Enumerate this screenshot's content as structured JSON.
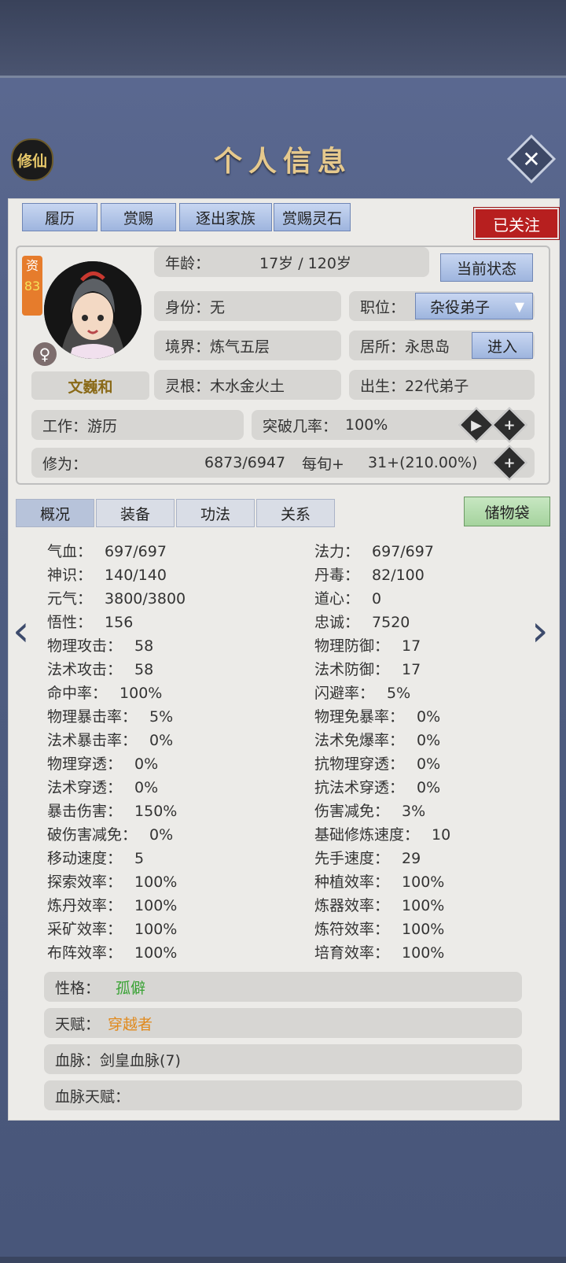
{
  "header": {
    "xiu_badge": "修仙",
    "title": "个人信息"
  },
  "actions": {
    "resume": "履历",
    "reward": "赏赐",
    "expel": "逐出家族",
    "reward_stones": "赏赐灵石",
    "followed": "已关注"
  },
  "profile": {
    "aptitude_label": "资",
    "aptitude_value": "83",
    "gender": "♀",
    "name": "文巍和",
    "age_label": "年龄：",
    "age_value": "17岁 / 120岁",
    "current_status_btn": "当前状态",
    "identity_label": "身份：",
    "identity_value": "无",
    "position_label": "职位：",
    "position_value": "杂役弟子",
    "realm_label": "境界：",
    "realm_value": "炼气五层",
    "residence_label": "居所：",
    "residence_value": "永思岛",
    "enter_btn": "进入",
    "root_label": "灵根：",
    "root_value": "木水金火土",
    "birth_label": "出生：",
    "birth_value": "22代弟子",
    "work_label": "工作：",
    "work_value": "游历",
    "breakthrough_label": "突破几率：",
    "breakthrough_value": "100%",
    "cultivation_label": "修为：",
    "cultivation_value": "6873/6947",
    "per_turn_label": "每旬+",
    "per_turn_value": "31+(210.00%)"
  },
  "tabs": [
    "概况",
    "装备",
    "功法",
    "关系"
  ],
  "storage_btn": "储物袋",
  "stats_left": [
    {
      "label": "气血：",
      "value": "697/697"
    },
    {
      "label": "神识：",
      "value": "140/140"
    },
    {
      "label": "元气：",
      "value": "3800/3800"
    },
    {
      "label": "悟性：",
      "value": "156"
    },
    {
      "label": "物理攻击：",
      "value": "58"
    },
    {
      "label": "法术攻击：",
      "value": "58"
    },
    {
      "label": "命中率：",
      "value": "100%"
    },
    {
      "label": "物理暴击率：",
      "value": "5%"
    },
    {
      "label": "法术暴击率：",
      "value": "0%"
    },
    {
      "label": "物理穿透：",
      "value": "0%"
    },
    {
      "label": "法术穿透：",
      "value": "0%"
    },
    {
      "label": "暴击伤害：",
      "value": "150%"
    },
    {
      "label": "破伤害减免：",
      "value": "0%"
    },
    {
      "label": "移动速度：",
      "value": "5"
    },
    {
      "label": "探索效率：",
      "value": "100%"
    },
    {
      "label": "炼丹效率：",
      "value": "100%"
    },
    {
      "label": "采矿效率：",
      "value": "100%"
    },
    {
      "label": "布阵效率：",
      "value": "100%"
    }
  ],
  "stats_right": [
    {
      "label": "法力：",
      "value": "697/697"
    },
    {
      "label": "丹毒：",
      "value": "82/100"
    },
    {
      "label": "道心：",
      "value": "0"
    },
    {
      "label": "忠诚：",
      "value": "7520"
    },
    {
      "label": "物理防御：",
      "value": "17"
    },
    {
      "label": "法术防御：",
      "value": "17"
    },
    {
      "label": "闪避率：",
      "value": "5%"
    },
    {
      "label": "物理免暴率：",
      "value": "0%"
    },
    {
      "label": "法术免爆率：",
      "value": "0%"
    },
    {
      "label": "抗物理穿透：",
      "value": "0%"
    },
    {
      "label": "抗法术穿透：",
      "value": "0%"
    },
    {
      "label": "伤害减免：",
      "value": "3%"
    },
    {
      "label": "基础修炼速度：",
      "value": "10"
    },
    {
      "label": "先手速度：",
      "value": "29"
    },
    {
      "label": "种植效率：",
      "value": "100%"
    },
    {
      "label": "炼器效率：",
      "value": "100%"
    },
    {
      "label": "炼符效率：",
      "value": "100%"
    },
    {
      "label": "培育效率：",
      "value": "100%"
    }
  ],
  "traits": {
    "personality_label": "性格：",
    "personality_value": "孤僻",
    "talent_label": "天赋：",
    "talent_value": "穿越者",
    "bloodline": "血脉：剑皇血脉(7)",
    "bloodline_talent": "血脉天赋："
  },
  "colors": {
    "personality": "#3aa335",
    "talent": "#e08a1e",
    "followed_bg": "#b71f1f"
  }
}
